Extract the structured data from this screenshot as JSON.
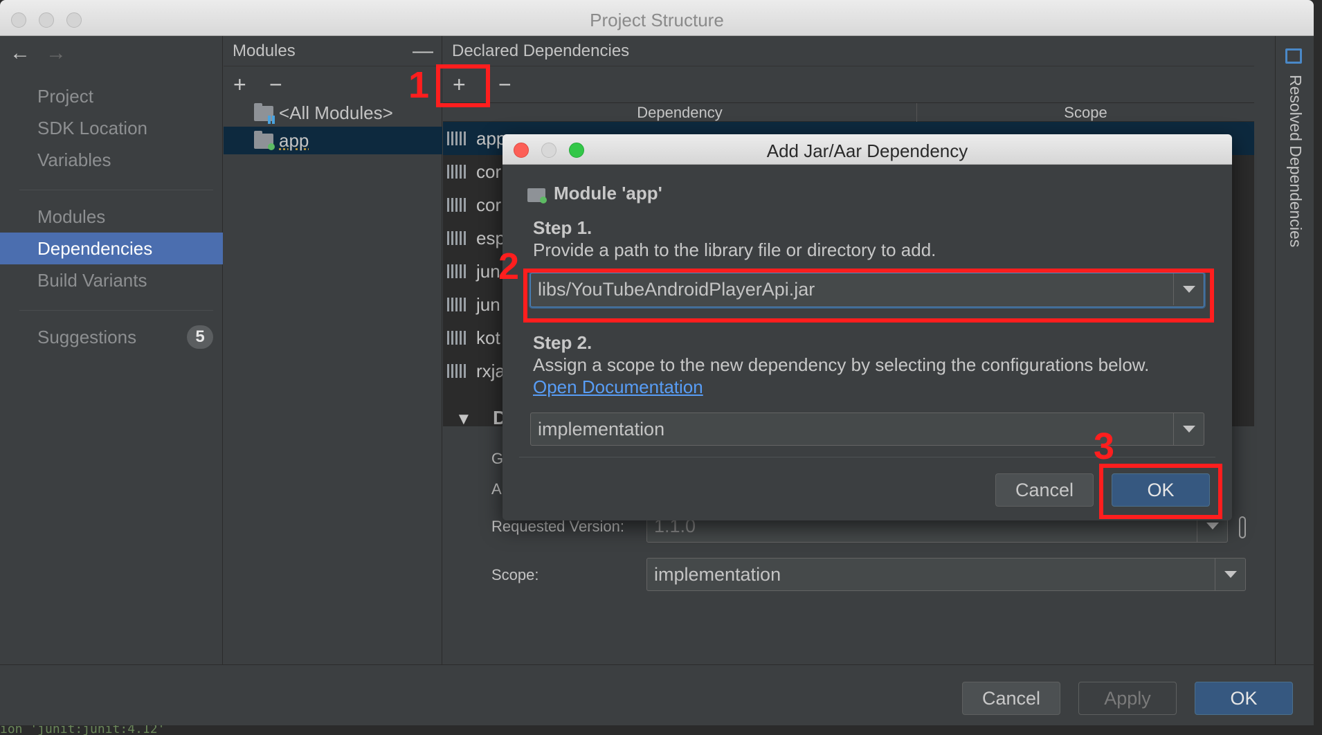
{
  "window": {
    "title": "Project Structure"
  },
  "nav": {
    "back": "←",
    "forward": "→",
    "items": [
      {
        "label": "Project"
      },
      {
        "label": "SDK Location"
      },
      {
        "label": "Variables"
      },
      {
        "label": "Modules"
      },
      {
        "label": "Dependencies"
      },
      {
        "label": "Build Variants"
      },
      {
        "label": "Suggestions",
        "badge": "5"
      }
    ]
  },
  "modules_panel": {
    "header": "Modules",
    "collapse_icon": "—",
    "add": "+",
    "remove": "−",
    "rows": [
      {
        "label": "<All Modules>"
      },
      {
        "label": "app"
      }
    ]
  },
  "deps_panel": {
    "header": "Declared Dependencies",
    "add": "+",
    "remove": "−",
    "columns": {
      "dependency": "Dependency",
      "scope": "Scope"
    },
    "rows": [
      {
        "label": "app"
      },
      {
        "label": "cor"
      },
      {
        "label": "cor"
      },
      {
        "label": "esp"
      },
      {
        "label": "jun"
      },
      {
        "label": "jun"
      },
      {
        "label": "kot"
      },
      {
        "label": "rxja"
      }
    ],
    "details": {
      "toggle": "▼",
      "section_initial": "D",
      "label_g": "G",
      "label_a": "A",
      "requested_version_label": "Requested Version:",
      "requested_version_value": "1.1.0",
      "scope_label": "Scope:",
      "scope_value": "implementation"
    }
  },
  "right_strip": {
    "label": "Resolved Dependencies"
  },
  "footer": {
    "cancel": "Cancel",
    "apply": "Apply",
    "ok": "OK"
  },
  "console": {
    "text": "ion 'junit:junit:4.12'"
  },
  "dialog": {
    "title": "Add Jar/Aar Dependency",
    "module": "Module 'app'",
    "step1_title": "Step 1.",
    "step1_text": "Provide a path to the library file or directory to add.",
    "path_value": "libs/YouTubeAndroidPlayerApi.jar",
    "step2_title": "Step 2.",
    "step2_text": "Assign a scope to the new dependency by selecting the configurations below.",
    "doc_link": "Open Documentation",
    "scope_value": "implementation",
    "cancel": "Cancel",
    "ok": "OK"
  },
  "annotations": {
    "n1": "1",
    "n2": "2",
    "n3": "3",
    "color": "#ff1e1e"
  }
}
